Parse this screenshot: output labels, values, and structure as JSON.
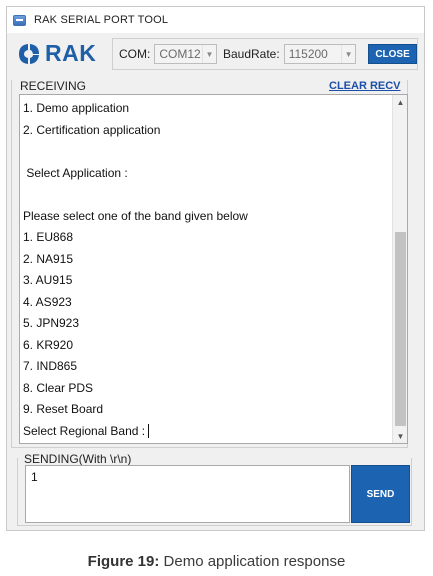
{
  "window": {
    "title": "RAK SERIAL PORT TOOL"
  },
  "logo": {
    "text": "RAK"
  },
  "settings": {
    "com_label": "COM:",
    "com_value": "COM12",
    "baud_label": "BaudRate:",
    "baud_value": "115200",
    "close_label": "CLOSE"
  },
  "receiving": {
    "label": "RECEIVING",
    "clear_label": "CLEAR RECV",
    "lines": [
      "1. Demo application",
      "2. Certification application",
      "",
      " Select Application :",
      "",
      "Please select one of the band given below",
      "1. EU868",
      "2. NA915",
      "3. AU915",
      "4. AS923",
      "5. JPN923",
      "6. KR920",
      "7. IND865",
      "8. Clear PDS",
      "9. Reset Board",
      "Select Regional Band :"
    ],
    "scroll_position": 0.55
  },
  "sending": {
    "label": "SENDING(With \\r\\n)",
    "value": "1",
    "send_label": "SEND"
  },
  "caption": {
    "prefix": "Figure 19:",
    "text": " Demo application response"
  },
  "colors": {
    "accent": "#1c63b1",
    "link": "#1c4fa8",
    "logo": "#1f5fa8"
  },
  "icons": {
    "app": "window-icon",
    "logo": "rak-logo-icon",
    "dropdown": "chevron-down-icon",
    "scroll_up": "chevron-up-icon",
    "scroll_down": "chevron-down-icon"
  }
}
